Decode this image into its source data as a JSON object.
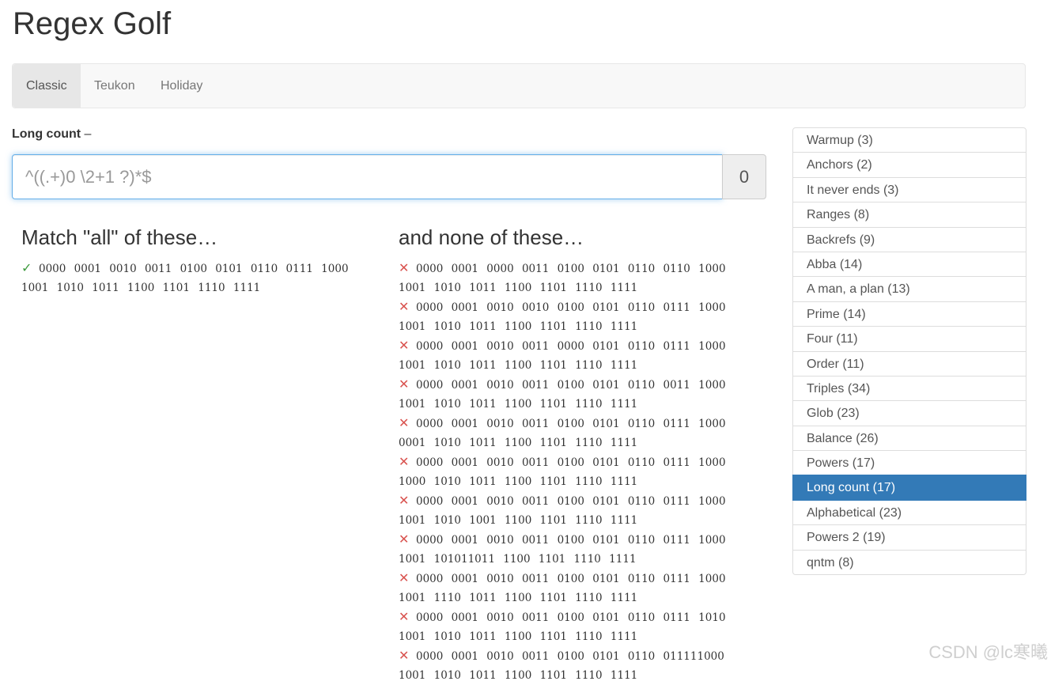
{
  "app": {
    "title": "Regex Golf"
  },
  "tabs": [
    {
      "label": "Classic",
      "active": true
    },
    {
      "label": "Teukon",
      "active": false
    },
    {
      "label": "Holiday",
      "active": false
    }
  ],
  "puzzle": {
    "name": "Long count",
    "separator": "–"
  },
  "regex": {
    "value": "",
    "placeholder": "^((.+)0 \\2+1 ?)*$",
    "score": "0"
  },
  "match": {
    "heading": "Match \"all\" of these…",
    "items": [
      "0000 0001 0010 0011 0100 0101 0110 0111 1000 1001 1010 1011 1100 1101 1110 1111"
    ]
  },
  "nomatch": {
    "heading": "and none of these…",
    "items": [
      "0000 0001 0000 0011 0100 0101 0110 0110 1000 1001 1010 1011 1100 1101 1110 1111",
      "0000 0001 0010 0010 0100 0101 0110 0111 1000 1001 1010 1011 1100 1101 1110 1111",
      "0000 0001 0010 0011 0000 0101 0110 0111 1000 1001 1010 1011 1100 1101 1110 1111",
      "0000 0001 0010 0011 0100 0101 0110 0011 1000 1001 1010 1011 1100 1101 1110 1111",
      "0000 0001 0010 0011 0100 0101 0110 0111 1000 0001 1010 1011 1100 1101 1110 1111",
      "0000 0001 0010 0011 0100 0101 0110 0111 1000 1000 1010 1011 1100 1101 1110 1111",
      "0000 0001 0010 0011 0100 0101 0110 0111 1000 1001 1010 1001 1100 1101 1110 1111",
      "0000 0001 0010 0011 0100 0101 0110 0111 1000 1001 101011011 1100 1101 1110 1111",
      "0000 0001 0010 0011 0100 0101 0110 0111 1000 1001 1110 1011 1100 1101 1110 1111",
      "0000 0001 0010 0011 0100 0101 0110 0111 1010 1001 1010 1011 1100 1101 1110 1111",
      "0000 0001 0010 0011 0100 0101 0110 011111000 1001 1010 1011 1100 1101 1110 1111"
    ]
  },
  "marks": {
    "ok": "✓",
    "bad": "✕"
  },
  "levels": [
    {
      "label": "Warmup (3)",
      "active": false
    },
    {
      "label": "Anchors (2)",
      "active": false
    },
    {
      "label": "It never ends (3)",
      "active": false
    },
    {
      "label": "Ranges (8)",
      "active": false
    },
    {
      "label": "Backrefs (9)",
      "active": false
    },
    {
      "label": "Abba (14)",
      "active": false
    },
    {
      "label": "A man, a plan (13)",
      "active": false
    },
    {
      "label": "Prime (14)",
      "active": false
    },
    {
      "label": "Four (11)",
      "active": false
    },
    {
      "label": "Order (11)",
      "active": false
    },
    {
      "label": "Triples (34)",
      "active": false
    },
    {
      "label": "Glob (23)",
      "active": false
    },
    {
      "label": "Balance (26)",
      "active": false
    },
    {
      "label": "Powers (17)",
      "active": false
    },
    {
      "label": "Long count (17)",
      "active": true
    },
    {
      "label": "Alphabetical (23)",
      "active": false
    },
    {
      "label": "Powers 2 (19)",
      "active": false
    },
    {
      "label": "qntm (8)",
      "active": false
    }
  ],
  "watermark": "CSDN @lc寒曦",
  "colors": {
    "accent": "#337ab7",
    "ok": "#3c9a3c",
    "bad": "#d9534f",
    "focus": "#66afe9"
  }
}
